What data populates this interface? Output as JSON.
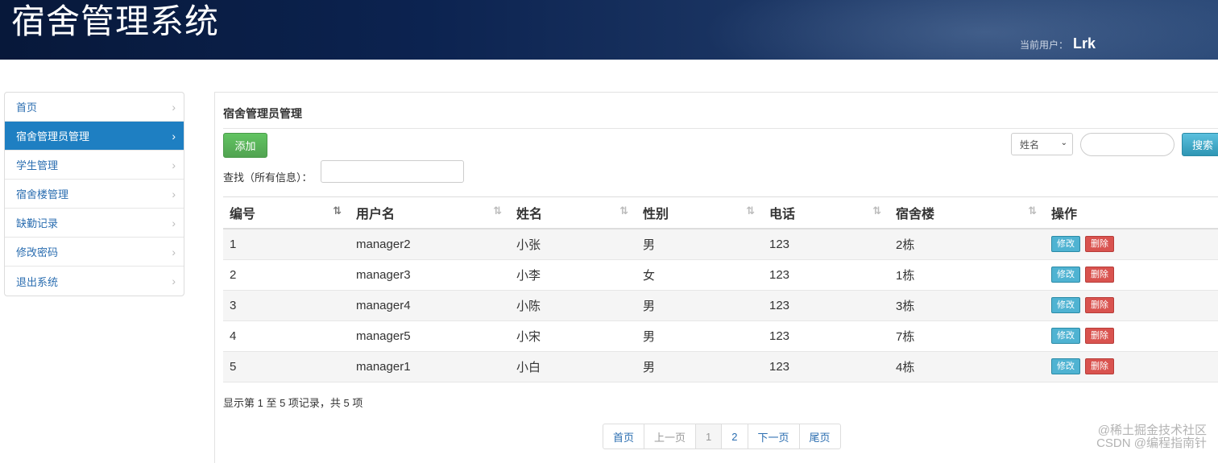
{
  "app": {
    "title": "宿舍管理系统",
    "current_user_label": "当前用户：",
    "current_user_name": "Lrk"
  },
  "sidebar": {
    "items": [
      {
        "label": "首页",
        "active": false
      },
      {
        "label": "宿舍管理员管理",
        "active": true
      },
      {
        "label": "学生管理",
        "active": false
      },
      {
        "label": "宿舍楼管理",
        "active": false
      },
      {
        "label": "缺勤记录",
        "active": false
      },
      {
        "label": "修改密码",
        "active": false
      },
      {
        "label": "退出系统",
        "active": false
      }
    ]
  },
  "main": {
    "title": "宿舍管理员管理",
    "add_button": "添加",
    "search_all_label": "查找（所有信息）：",
    "search_all_value": "",
    "field_select_value": "姓名",
    "search_value": "",
    "search_button": "搜索",
    "table": {
      "headers": [
        "编号",
        "用户名",
        "姓名",
        "性别",
        "电话",
        "宿舍楼",
        "操作"
      ],
      "rows": [
        {
          "id": "1",
          "username": "manager2",
          "name": "小张",
          "gender": "男",
          "phone": "123",
          "building": "2栋"
        },
        {
          "id": "2",
          "username": "manager3",
          "name": "小李",
          "gender": "女",
          "phone": "123",
          "building": "1栋"
        },
        {
          "id": "3",
          "username": "manager4",
          "name": "小陈",
          "gender": "男",
          "phone": "123",
          "building": "3栋"
        },
        {
          "id": "4",
          "username": "manager5",
          "name": "小宋",
          "gender": "男",
          "phone": "123",
          "building": "7栋"
        },
        {
          "id": "5",
          "username": "manager1",
          "name": "小白",
          "gender": "男",
          "phone": "123",
          "building": "4栋"
        }
      ],
      "edit_label": "修改",
      "delete_label": "删除"
    },
    "summary": "显示第 1 至 5 项记录，共 5 项",
    "pagination": [
      "首页",
      "上一页",
      "1",
      "2",
      "下一页",
      "尾页"
    ]
  },
  "watermark": {
    "line1": "@稀土掘金技术社区",
    "line2": "CSDN @编程指南针"
  },
  "colors": {
    "accent": "#1e7fc2",
    "add": "#5cb85c",
    "search": "#5bc0de",
    "delete": "#d9534f"
  }
}
